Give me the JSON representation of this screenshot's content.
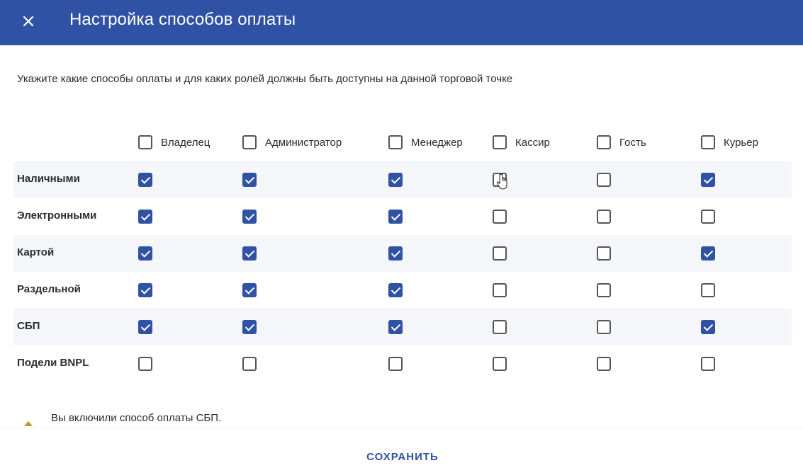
{
  "dialog": {
    "title": "Настройка способов оплаты",
    "subtitle": "Укажите какие способы оплаты и для каких ролей должны быть доступны на данной торговой точке"
  },
  "roles": [
    {
      "label": "Владелец",
      "checked": false
    },
    {
      "label": "Администратор",
      "checked": false
    },
    {
      "label": "Менеджер",
      "checked": false
    },
    {
      "label": "Кассир",
      "checked": false
    },
    {
      "label": "Гость",
      "checked": false
    },
    {
      "label": "Курьер",
      "checked": false
    }
  ],
  "methods": [
    {
      "label": "Наличными",
      "checks": [
        true,
        true,
        true,
        false,
        false,
        true
      ]
    },
    {
      "label": "Электронными",
      "checks": [
        true,
        true,
        true,
        false,
        false,
        false
      ]
    },
    {
      "label": "Картой",
      "checks": [
        true,
        true,
        true,
        false,
        false,
        true
      ]
    },
    {
      "label": "Раздельной",
      "checks": [
        true,
        true,
        true,
        false,
        false,
        false
      ]
    },
    {
      "label": "СБП",
      "checks": [
        true,
        true,
        true,
        false,
        false,
        true
      ]
    },
    {
      "label": "Подели BNPL",
      "checks": [
        false,
        false,
        false,
        false,
        false,
        false
      ]
    }
  ],
  "notice": {
    "icon": "chevron-up-icon",
    "text": "Вы включили способ оплаты СБП.",
    "color": "#c8931e"
  },
  "footer": {
    "save_label": "СОХРАНИТЬ"
  },
  "colors": {
    "accent": "#2f52a5",
    "header_bg": "#2f52a5"
  }
}
